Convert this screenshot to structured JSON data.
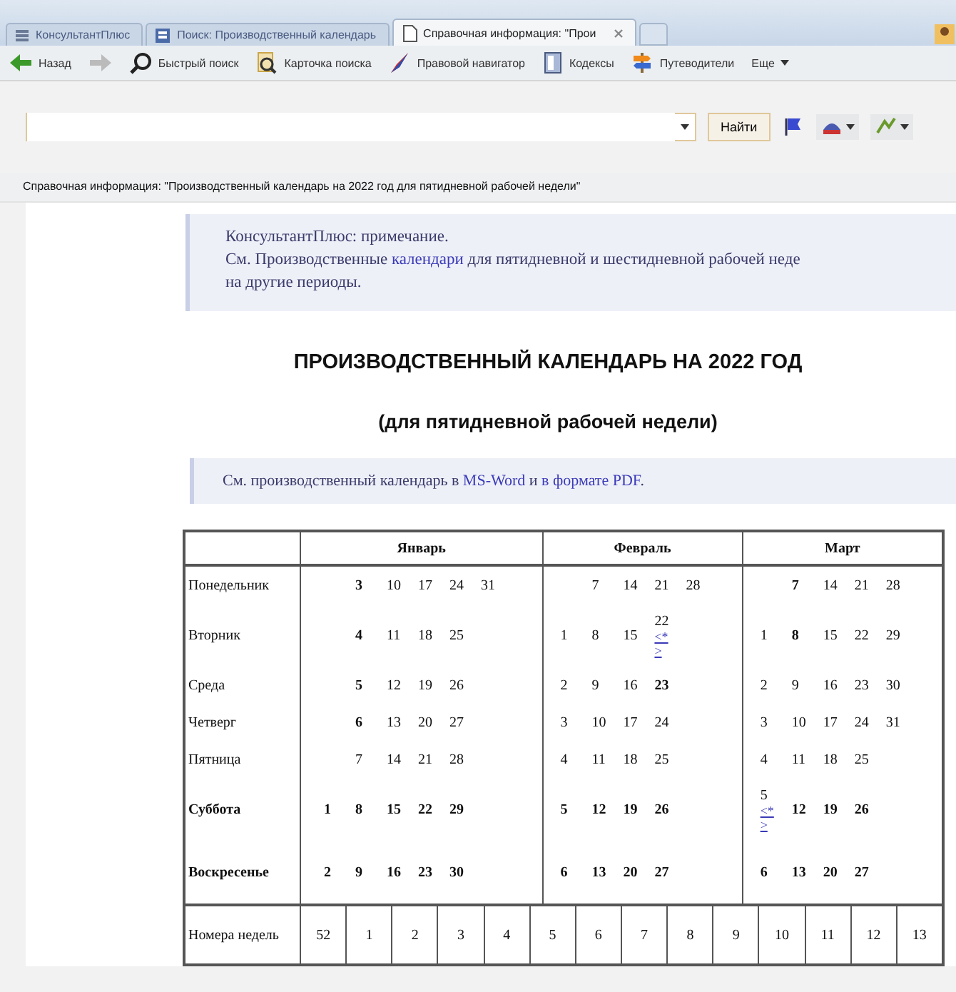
{
  "browser_tabs": [
    {
      "label": "КонсультантПлюс",
      "selected": false,
      "kind": "home"
    },
    {
      "label": "Поиск: Производственный календарь",
      "selected": false,
      "kind": "search"
    },
    {
      "label": "Справочная информация: \"Прои",
      "selected": true,
      "kind": "doc"
    }
  ],
  "toolbar": [
    {
      "label": "Назад",
      "kind": "back"
    },
    {
      "kind": "forward"
    },
    {
      "label": "Быстрый поиск",
      "kind": "search"
    },
    {
      "label": "Карточка поиска",
      "kind": "card"
    },
    {
      "label": "Правовой навигатор",
      "kind": "navigator"
    },
    {
      "label": "Кодексы",
      "kind": "codes"
    },
    {
      "label": "Путеводители",
      "kind": "guides"
    },
    {
      "label": "Еще",
      "kind": "more"
    }
  ],
  "search": {
    "button": "Найти"
  },
  "breadcrumb": "Справочная информация: \"Производственный календарь на 2022 год для пятидневной рабочей недели\"",
  "note": {
    "title": "КонсультантПлюс: примечание.",
    "lines": [
      [
        {
          "text": "См. Производственные ",
          "link": false
        },
        {
          "text": "календари",
          "link": true
        },
        {
          "text": " для пятидневной и шестидневной рабочей неде",
          "link": false
        }
      ],
      [
        {
          "text": "на другие периоды.",
          "link": false
        }
      ]
    ]
  },
  "heading": "ПРОИЗВОДСТВЕННЫЙ КАЛЕНДАРЬ НА 2022 ГОД",
  "subheading": "(для пятидневной рабочей недели)",
  "downloads": [
    {
      "text": "См. производственный календарь в ",
      "link": false
    },
    {
      "text": "MS-Word",
      "link": true
    },
    {
      "text": " и ",
      "link": false
    },
    {
      "text": "в формате PDF",
      "link": true
    },
    {
      "text": ".",
      "link": false
    }
  ],
  "calendar": {
    "months": [
      "Январь",
      "Февраль",
      "Март"
    ],
    "rows": [
      {
        "weekday": "Понедельник",
        "weekend": false,
        "months": [
          {
            "lead_blank": true,
            "days": [
              {
                "text": "3",
                "bold": true
              },
              {
                "text": "10",
                "bold": false
              },
              {
                "text": "17",
                "bold": false
              },
              {
                "text": "24",
                "bold": false
              },
              {
                "text": "31",
                "bold": false
              }
            ]
          },
          {
            "lead_blank": true,
            "days": [
              {
                "text": "7",
                "bold": false
              },
              {
                "text": "14",
                "bold": false
              },
              {
                "text": "21",
                "bold": false
              },
              {
                "text": "28",
                "bold": false
              }
            ]
          },
          {
            "lead_blank": true,
            "days": [
              {
                "text": "7",
                "bold": true
              },
              {
                "text": "14",
                "bold": false
              },
              {
                "text": "21",
                "bold": false
              },
              {
                "text": "28",
                "bold": false
              }
            ]
          }
        ]
      },
      {
        "weekday": "Вторник",
        "weekend": false,
        "months": [
          {
            "lead_blank": true,
            "days": [
              {
                "text": "4",
                "bold": true
              },
              {
                "text": "11",
                "bold": false
              },
              {
                "text": "18",
                "bold": false
              },
              {
                "text": "25",
                "bold": false
              }
            ]
          },
          {
            "lead_blank": false,
            "days": [
              {
                "text": "1",
                "bold": false
              },
              {
                "text": "8",
                "bold": false
              },
              {
                "text": "15",
                "bold": false
              },
              {
                "text": "22",
                "bold": false,
                "note": "<*>"
              }
            ]
          },
          {
            "lead_blank": false,
            "days": [
              {
                "text": "1",
                "bold": false
              },
              {
                "text": "8",
                "bold": true
              },
              {
                "text": "15",
                "bold": false
              },
              {
                "text": "22",
                "bold": false
              },
              {
                "text": "29",
                "bold": false
              }
            ]
          }
        ]
      },
      {
        "weekday": "Среда",
        "weekend": false,
        "months": [
          {
            "lead_blank": true,
            "days": [
              {
                "text": "5",
                "bold": true
              },
              {
                "text": "12",
                "bold": false
              },
              {
                "text": "19",
                "bold": false
              },
              {
                "text": "26",
                "bold": false
              }
            ]
          },
          {
            "lead_blank": false,
            "days": [
              {
                "text": "2",
                "bold": false
              },
              {
                "text": "9",
                "bold": false
              },
              {
                "text": "16",
                "bold": false
              },
              {
                "text": "23",
                "bold": true
              }
            ]
          },
          {
            "lead_blank": false,
            "days": [
              {
                "text": "2",
                "bold": false
              },
              {
                "text": "9",
                "bold": false
              },
              {
                "text": "16",
                "bold": false
              },
              {
                "text": "23",
                "bold": false
              },
              {
                "text": "30",
                "bold": false
              }
            ]
          }
        ]
      },
      {
        "weekday": "Четверг",
        "weekend": false,
        "months": [
          {
            "lead_blank": true,
            "days": [
              {
                "text": "6",
                "bold": true
              },
              {
                "text": "13",
                "bold": false
              },
              {
                "text": "20",
                "bold": false
              },
              {
                "text": "27",
                "bold": false
              }
            ]
          },
          {
            "lead_blank": false,
            "days": [
              {
                "text": "3",
                "bold": false
              },
              {
                "text": "10",
                "bold": false
              },
              {
                "text": "17",
                "bold": false
              },
              {
                "text": "24",
                "bold": false
              }
            ]
          },
          {
            "lead_blank": false,
            "days": [
              {
                "text": "3",
                "bold": false
              },
              {
                "text": "10",
                "bold": false
              },
              {
                "text": "17",
                "bold": false
              },
              {
                "text": "24",
                "bold": false
              },
              {
                "text": "31",
                "bold": false
              }
            ]
          }
        ]
      },
      {
        "weekday": "Пятница",
        "weekend": false,
        "months": [
          {
            "lead_blank": true,
            "days": [
              {
                "text": "7",
                "bold": false
              },
              {
                "text": "14",
                "bold": false
              },
              {
                "text": "21",
                "bold": false
              },
              {
                "text": "28",
                "bold": false
              }
            ]
          },
          {
            "lead_blank": false,
            "days": [
              {
                "text": "4",
                "bold": false
              },
              {
                "text": "11",
                "bold": false
              },
              {
                "text": "18",
                "bold": false
              },
              {
                "text": "25",
                "bold": false
              }
            ]
          },
          {
            "lead_blank": false,
            "days": [
              {
                "text": "4",
                "bold": false
              },
              {
                "text": "11",
                "bold": false
              },
              {
                "text": "18",
                "bold": false
              },
              {
                "text": "25",
                "bold": false
              }
            ]
          }
        ]
      },
      {
        "weekday": "Суббота",
        "weekend": true,
        "months": [
          {
            "lead_blank": false,
            "days": [
              {
                "text": "1",
                "bold": true
              },
              {
                "text": "8",
                "bold": true
              },
              {
                "text": "15",
                "bold": true
              },
              {
                "text": "22",
                "bold": true
              },
              {
                "text": "29",
                "bold": true
              }
            ]
          },
          {
            "lead_blank": false,
            "days": [
              {
                "text": "5",
                "bold": true
              },
              {
                "text": "12",
                "bold": true
              },
              {
                "text": "19",
                "bold": true
              },
              {
                "text": "26",
                "bold": true
              }
            ]
          },
          {
            "lead_blank": false,
            "days": [
              {
                "text": "5",
                "bold": false,
                "note": "<*>"
              },
              {
                "text": "12",
                "bold": true
              },
              {
                "text": "19",
                "bold": true
              },
              {
                "text": "26",
                "bold": true
              }
            ]
          }
        ]
      },
      {
        "weekday": "Воскресенье",
        "weekend": true,
        "months": [
          {
            "lead_blank": false,
            "days": [
              {
                "text": "2",
                "bold": true
              },
              {
                "text": "9",
                "bold": true
              },
              {
                "text": "16",
                "bold": true
              },
              {
                "text": "23",
                "bold": true
              },
              {
                "text": "30",
                "bold": true
              }
            ]
          },
          {
            "lead_blank": false,
            "days": [
              {
                "text": "6",
                "bold": true
              },
              {
                "text": "13",
                "bold": true
              },
              {
                "text": "20",
                "bold": true
              },
              {
                "text": "27",
                "bold": true
              }
            ]
          },
          {
            "lead_blank": false,
            "days": [
              {
                "text": "6",
                "bold": true
              },
              {
                "text": "13",
                "bold": true
              },
              {
                "text": "20",
                "bold": true
              },
              {
                "text": "27",
                "bold": true
              }
            ]
          }
        ]
      }
    ],
    "weeks_label": "Номера недель",
    "weeks": [
      "52",
      "1",
      "2",
      "3",
      "4",
      "5",
      "6",
      "7",
      "8",
      "9",
      "10",
      "11",
      "12",
      "13"
    ]
  }
}
